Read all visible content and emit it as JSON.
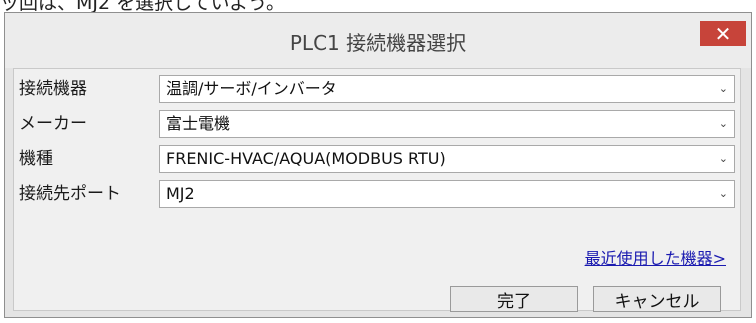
{
  "caption": "ッ回は、MJ2 を選択していよう。",
  "dialog": {
    "title": "PLC1 接続機器選択",
    "close_symbol": "✕",
    "fields": [
      {
        "label": "接続機器",
        "value": "温調/サーボ/インバータ"
      },
      {
        "label": "メーカー",
        "value": "富士電機"
      },
      {
        "label": "機種",
        "value": "FRENIC-HVAC/AQUA(MODBUS RTU)"
      },
      {
        "label": "接続先ポート",
        "value": "MJ2"
      }
    ],
    "recent_link": "最近使用した機器>",
    "ok_label": "完了",
    "cancel_label": "キャンセル",
    "chevron_symbol": "⌄"
  }
}
